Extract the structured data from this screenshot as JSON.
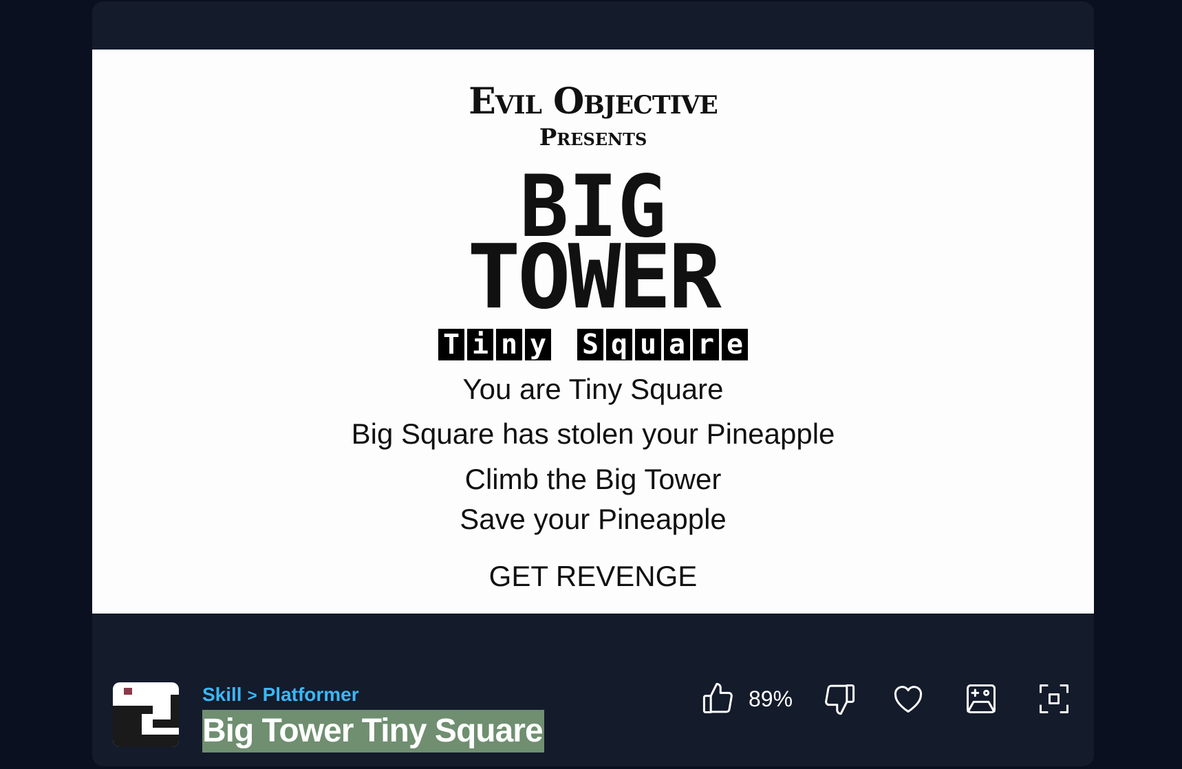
{
  "game_screen": {
    "studio": "Evil Objective",
    "presents": "Presents",
    "logo_big": "BIG",
    "logo_tower": "TOWER",
    "logo_tiny_word1": [
      "T",
      "i",
      "n",
      "y"
    ],
    "logo_tiny_word2": [
      "S",
      "q",
      "u",
      "a",
      "r",
      "e"
    ],
    "lines": [
      "You are Tiny Square",
      "Big Square has stolen your Pineapple",
      "Climb the Big Tower",
      "Save your Pineapple",
      "GET REVENGE"
    ]
  },
  "info": {
    "category": "Skill",
    "separator": ">",
    "subcategory": "Platformer",
    "title": "Big Tower Tiny Square",
    "rating": "89%"
  },
  "icons": {
    "like": "thumbs-up-icon",
    "dislike": "thumbs-down-icon",
    "favorite": "heart-icon",
    "controls": "gamepad-icon",
    "fullscreen": "fullscreen-icon"
  },
  "colors": {
    "page_bg": "#0b1020",
    "frame_bg": "#141b2b",
    "accent": "#3bb7f5",
    "title_highlight": "#6f8f70"
  }
}
